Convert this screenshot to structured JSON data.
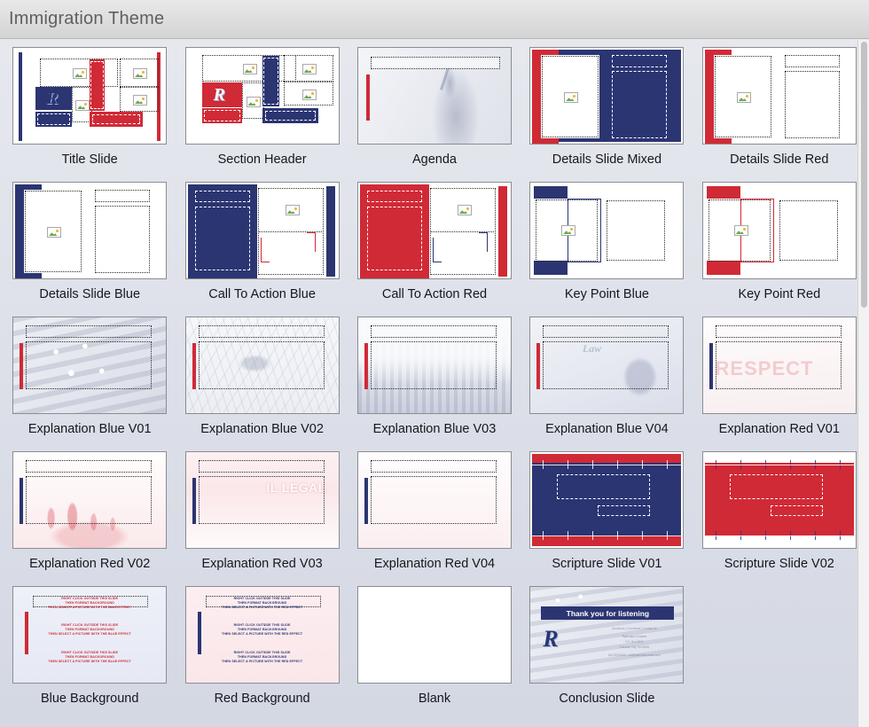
{
  "header": {
    "title": "Immigration Theme"
  },
  "colors": {
    "blue": "#2b3572",
    "red": "#d02a36",
    "panel_background": "#dcdfe8",
    "thumb_border": "#8b8d90",
    "label_text": "#16171a"
  },
  "slides": [
    {
      "id": "title-slide",
      "label": "Title Slide"
    },
    {
      "id": "section-header",
      "label": "Section Header"
    },
    {
      "id": "agenda",
      "label": "Agenda"
    },
    {
      "id": "details-slide-mixed",
      "label": "Details Slide Mixed"
    },
    {
      "id": "details-slide-red",
      "label": "Details Slide Red"
    },
    {
      "id": "details-slide-blue",
      "label": "Details Slide Blue"
    },
    {
      "id": "call-to-action-blue",
      "label": "Call To Action Blue"
    },
    {
      "id": "call-to-action-red",
      "label": "Call To Action Red"
    },
    {
      "id": "key-point-blue",
      "label": "Key Point Blue"
    },
    {
      "id": "key-point-red",
      "label": "Key Point Red"
    },
    {
      "id": "explanation-blue-v01",
      "label": "Explanation Blue V01"
    },
    {
      "id": "explanation-blue-v02",
      "label": "Explanation Blue V02"
    },
    {
      "id": "explanation-blue-v03",
      "label": "Explanation Blue V03"
    },
    {
      "id": "explanation-blue-v04",
      "label": "Explanation Blue V04"
    },
    {
      "id": "explanation-red-v01",
      "label": "Explanation Red V01"
    },
    {
      "id": "explanation-red-v02",
      "label": "Explanation Red V02"
    },
    {
      "id": "explanation-red-v03",
      "label": "Explanation Red V03"
    },
    {
      "id": "explanation-red-v04",
      "label": "Explanation Red V04"
    },
    {
      "id": "scripture-slide-v01",
      "label": "Scripture Slide V01"
    },
    {
      "id": "scripture-slide-v02",
      "label": "Scripture Slide V02"
    },
    {
      "id": "blue-background",
      "label": "Blue Background"
    },
    {
      "id": "red-background",
      "label": "Red Background"
    },
    {
      "id": "blank",
      "label": "Blank"
    },
    {
      "id": "conclusion-slide",
      "label": "Conclusion Slide"
    }
  ],
  "slide_content": {
    "logo_letter": "R",
    "blue_background_instructions": {
      "line1": "RIGHT CLICK OUTSIDE THIS SLIDE",
      "line2": "THEN FORMAT BACKGROUND",
      "line3": "THEN SELECT A PICTURE WITH THE BLUE EFFECT"
    },
    "red_background_instructions": {
      "line1": "RIGHT CLICK OUTSIDE THIS SLIDE",
      "line2": "THEN FORMAT BACKGROUND",
      "line3": "THEN SELECT A PICTURE WITH THE RED EFFECT"
    },
    "conclusion": {
      "headline": "Thank you for listening",
      "contact_line1": "Questions | Comments | Contact Us",
      "contact_line2": "Rainmaker Einstein",
      "contact_line3": "P.O. Box 5847",
      "contact_line4": "Traverse City, MI 49696",
      "contact_line5": "844.999.8406 - info@rainmakermain.com"
    },
    "explanation_blue_v04_word": "Law",
    "explanation_red_v01_word": "RESPECT",
    "explanation_red_v03_word": "IL LEGAL"
  }
}
